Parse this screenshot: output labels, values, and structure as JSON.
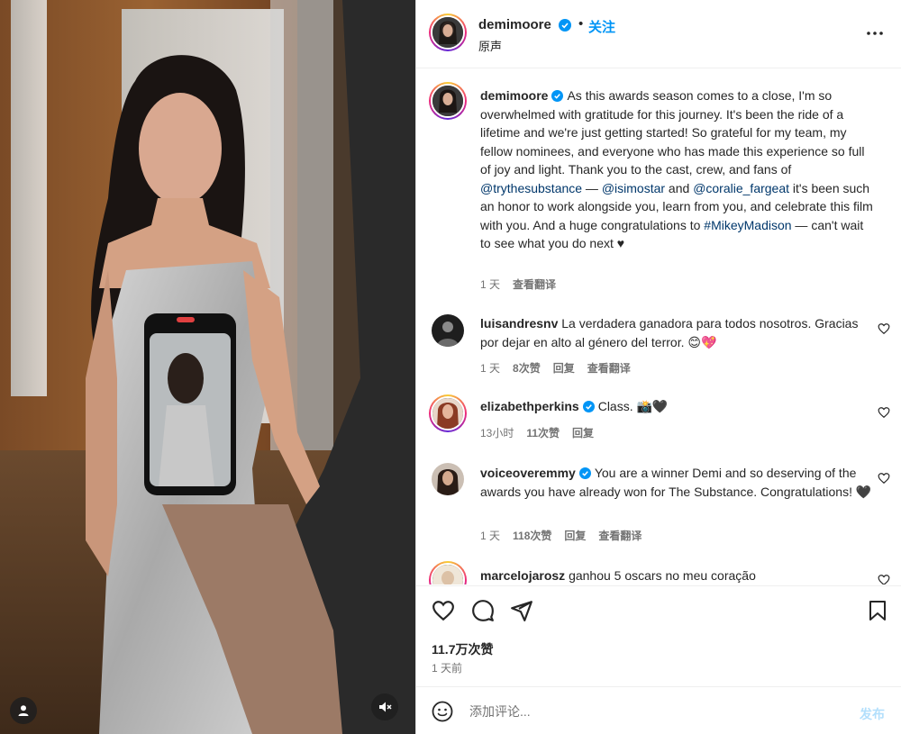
{
  "post": {
    "username": "demimoore",
    "follow_label": "关注",
    "audio_label": "原声",
    "more_icon": "more-horizontal-icon"
  },
  "caption": {
    "username": "demimoore",
    "text_1": "As this awards season comes to a close, I'm so overwhelmed with gratitude for this journey. It's been the ride of a lifetime and we're just getting started! So grateful for my team, my fellow nominees, and everyone who has made this experience so full of joy and light. Thank you to the cast, crew, and fans of ",
    "mention_1": "@trythesubstance",
    "text_2": " — ",
    "mention_2": "@isimostar",
    "text_3": " and ",
    "mention_3": "@coralie_fargeat",
    "text_4": " it's been such an honor to work alongside you, learn from you, and celebrate this film with you. And a huge congratulations to ",
    "hashtag": "#MikeyMadison",
    "text_5": " — can't wait to see what you do next ♥",
    "time": "1 天",
    "translate": "查看翻译"
  },
  "comments": [
    {
      "username": "luisandresnv",
      "text": "La verdadera ganadora para todos nosotros. Gracias por dejar en alto al género del terror. 😊💖",
      "time": "1 天",
      "likes": "8次赞",
      "reply": "回复",
      "translate": "查看翻译"
    },
    {
      "username": "elizabethperkins",
      "text": "Class. 📸🖤",
      "time": "13小时",
      "likes": "11次赞",
      "reply": "回复"
    },
    {
      "username": "voiceoveremmy",
      "text": "You are a winner Demi and so deserving of the awards you have already won for The Substance. Congratulations! 🖤",
      "time": "1 天",
      "likes": "118次赞",
      "reply": "回复",
      "translate": "查看翻译"
    },
    {
      "username": "marcelojarosz",
      "text": "ganhou 5 oscars no meu coração"
    }
  ],
  "stats": {
    "likes": "11.7万次赞",
    "posted": "1 天前"
  },
  "composer": {
    "placeholder": "添加评论...",
    "post_label": "发布"
  },
  "colors": {
    "accent": "#0095f6",
    "link": "#00376b",
    "muted": "#737373"
  }
}
